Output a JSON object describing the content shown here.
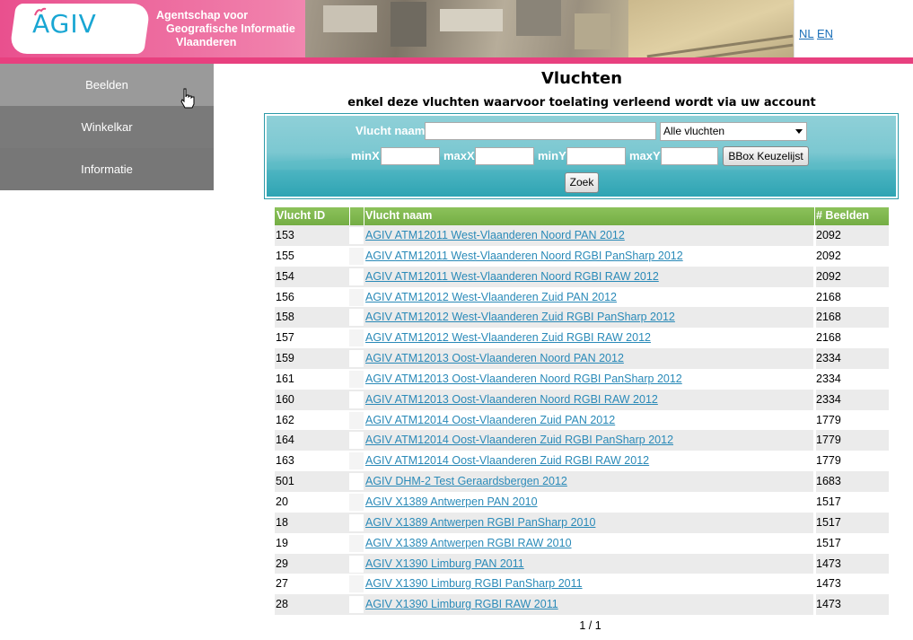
{
  "header": {
    "logo_text": "AGIV",
    "agency_lines": [
      "Agentschap voor",
      "Geografische Informatie",
      "Vlaanderen"
    ],
    "lang_nl": "NL",
    "lang_en": "EN"
  },
  "sidebar": {
    "items": [
      {
        "label": "Beelden"
      },
      {
        "label": "Winkelkar"
      },
      {
        "label": "Informatie"
      }
    ]
  },
  "page": {
    "title": "Vluchten",
    "subtitle": "enkel deze vluchten waarvoor toelating verleend wordt via uw account"
  },
  "search": {
    "name_label": "Vlucht naam",
    "name_value": "",
    "filter_selected": "Alle vluchten",
    "minx_label": "minX",
    "maxx_label": "maxX",
    "miny_label": "minY",
    "maxy_label": "maxY",
    "bbox_button": "BBox Keuzelijst",
    "search_button": "Zoek"
  },
  "table": {
    "headers": {
      "id": "Vlucht ID",
      "name": "Vlucht naam",
      "count": "# Beelden"
    },
    "rows": [
      {
        "id": "153",
        "name": "AGIV ATM12011 West-Vlaanderen Noord PAN 2012",
        "count": "2092"
      },
      {
        "id": "155",
        "name": "AGIV ATM12011 West-Vlaanderen Noord RGBI PanSharp 2012",
        "count": "2092"
      },
      {
        "id": "154",
        "name": "AGIV ATM12011 West-Vlaanderen Noord RGBI RAW 2012",
        "count": "2092"
      },
      {
        "id": "156",
        "name": "AGIV ATM12012 West-Vlaanderen Zuid PAN 2012",
        "count": "2168"
      },
      {
        "id": "158",
        "name": "AGIV ATM12012 West-Vlaanderen Zuid RGBI PanSharp 2012",
        "count": "2168"
      },
      {
        "id": "157",
        "name": "AGIV ATM12012 West-Vlaanderen Zuid RGBI RAW 2012",
        "count": "2168"
      },
      {
        "id": "159",
        "name": "AGIV ATM12013 Oost-Vlaanderen Noord PAN 2012",
        "count": "2334"
      },
      {
        "id": "161",
        "name": "AGIV ATM12013 Oost-Vlaanderen Noord RGBI PanSharp 2012",
        "count": "2334"
      },
      {
        "id": "160",
        "name": "AGIV ATM12013 Oost-Vlaanderen Noord RGBI RAW 2012",
        "count": "2334"
      },
      {
        "id": "162",
        "name": "AGIV ATM12014 Oost-Vlaanderen Zuid PAN 2012",
        "count": "1779"
      },
      {
        "id": "164",
        "name": "AGIV ATM12014 Oost-Vlaanderen Zuid RGBI PanSharp 2012",
        "count": "1779"
      },
      {
        "id": "163",
        "name": "AGIV ATM12014 Oost-Vlaanderen Zuid RGBI RAW 2012",
        "count": "1779"
      },
      {
        "id": "501",
        "name": "AGIV DHM-2 Test Geraardsbergen 2012",
        "count": "1683"
      },
      {
        "id": "20",
        "name": "AGIV X1389 Antwerpen PAN 2010",
        "count": "1517"
      },
      {
        "id": "18",
        "name": "AGIV X1389 Antwerpen RGBI PanSharp 2010",
        "count": "1517"
      },
      {
        "id": "19",
        "name": "AGIV X1389 Antwerpen RGBI RAW 2010",
        "count": "1517"
      },
      {
        "id": "29",
        "name": "AGIV X1390 Limburg PAN 2011",
        "count": "1473"
      },
      {
        "id": "27",
        "name": "AGIV X1390 Limburg RGBI PanSharp 2011",
        "count": "1473"
      },
      {
        "id": "28",
        "name": "AGIV X1390 Limburg RGBI RAW 2011",
        "count": "1473"
      }
    ]
  },
  "pager": {
    "text": "1 / 1"
  },
  "colors": {
    "header_pink": "#e9508e",
    "table_header_green": "#7cb54a",
    "search_teal": "#4ab3c0",
    "link_blue": "#2a8ab8"
  }
}
